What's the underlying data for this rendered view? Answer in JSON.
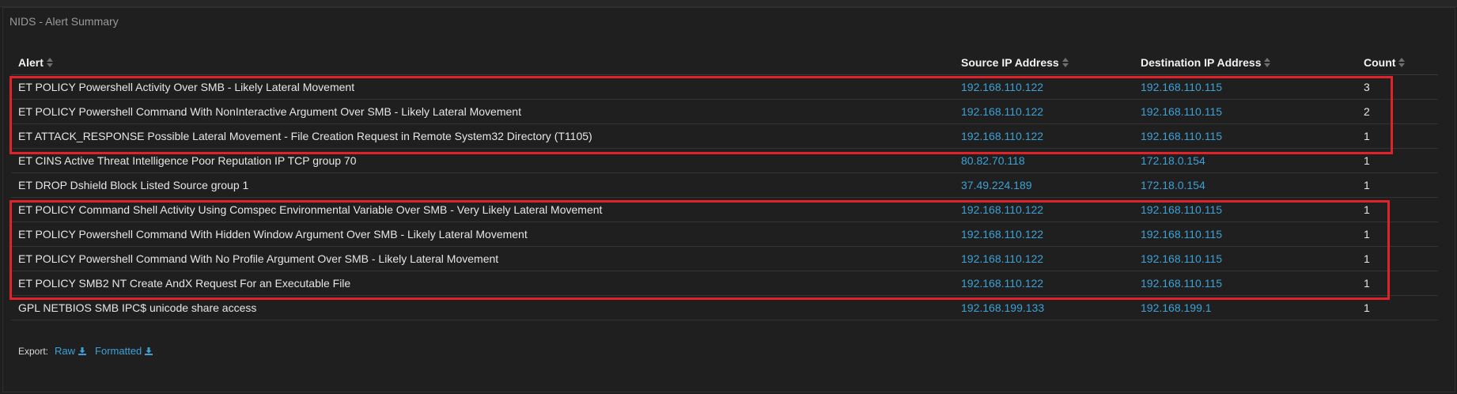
{
  "panel": {
    "title": "NIDS - Alert Summary"
  },
  "table": {
    "columns": [
      {
        "label": "Alert",
        "sort_icon": "sort-icon"
      },
      {
        "label": "Source IP Address",
        "sort_icon": "sort-icon"
      },
      {
        "label": "Destination IP Address",
        "sort_icon": "sort-icon"
      },
      {
        "label": "Count",
        "sort_icon": "sort-icon"
      }
    ],
    "rows": [
      {
        "alert": "ET POLICY Powershell Activity Over SMB - Likely Lateral Movement",
        "src": "192.168.110.122",
        "dst": "192.168.110.115",
        "count": "3"
      },
      {
        "alert": "ET POLICY Powershell Command With NonInteractive Argument Over SMB - Likely Lateral Movement",
        "src": "192.168.110.122",
        "dst": "192.168.110.115",
        "count": "2"
      },
      {
        "alert": "ET ATTACK_RESPONSE Possible Lateral Movement - File Creation Request in Remote System32 Directory (T1105)",
        "src": "192.168.110.122",
        "dst": "192.168.110.115",
        "count": "1"
      },
      {
        "alert": "ET CINS Active Threat Intelligence Poor Reputation IP TCP group 70",
        "src": "80.82.70.118",
        "dst": "172.18.0.154",
        "count": "1"
      },
      {
        "alert": "ET DROP Dshield Block Listed Source group 1",
        "src": "37.49.224.189",
        "dst": "172.18.0.154",
        "count": "1"
      },
      {
        "alert": "ET POLICY Command Shell Activity Using Comspec Environmental Variable Over SMB - Very Likely Lateral Movement",
        "src": "192.168.110.122",
        "dst": "192.168.110.115",
        "count": "1"
      },
      {
        "alert": "ET POLICY Powershell Command With Hidden Window Argument Over SMB - Likely Lateral Movement",
        "src": "192.168.110.122",
        "dst": "192.168.110.115",
        "count": "1"
      },
      {
        "alert": "ET POLICY Powershell Command With No Profile Argument Over SMB - Likely Lateral Movement",
        "src": "192.168.110.122",
        "dst": "192.168.110.115",
        "count": "1"
      },
      {
        "alert": "ET POLICY SMB2 NT Create AndX Request For an Executable File",
        "src": "192.168.110.122",
        "dst": "192.168.110.115",
        "count": "1"
      },
      {
        "alert": "GPL NETBIOS SMB IPC$ unicode share access",
        "src": "192.168.199.133",
        "dst": "192.168.199.1",
        "count": "1"
      }
    ]
  },
  "export": {
    "label": "Export:",
    "raw_label": "Raw",
    "formatted_label": "Formatted",
    "icon": "download-icon"
  },
  "colors": {
    "background": "#1f1f1f",
    "link": "#3ea1d6",
    "highlight": "#e0232b",
    "title_text": "#9a9a9a"
  }
}
